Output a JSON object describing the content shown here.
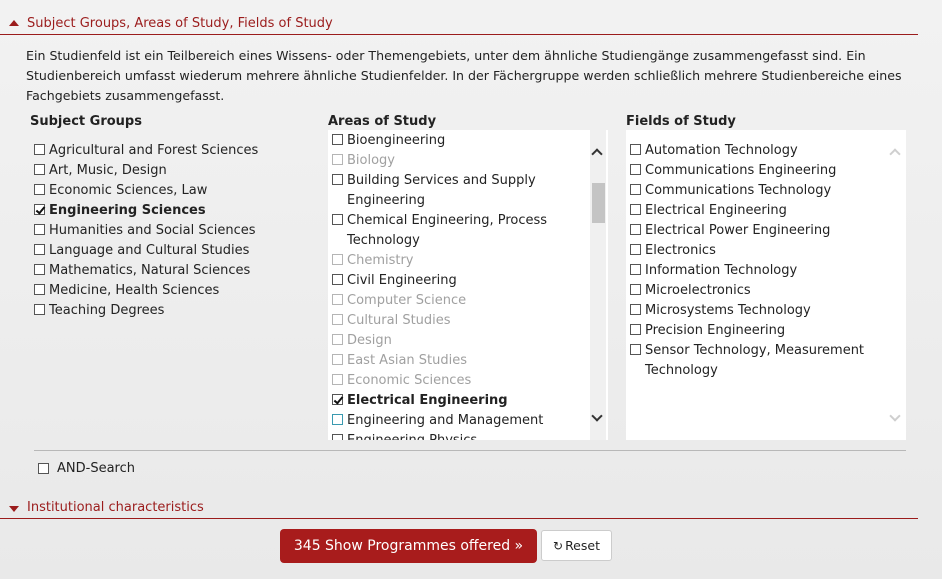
{
  "sections": {
    "subject": "Subject Groups, Areas of Study, Fields of Study",
    "institutional": "Institutional characteristics"
  },
  "description": "Ein Studienfeld ist ein Teilbereich eines Wissens- oder Themengebiets, unter dem ähnliche Studiengänge zusammengefasst sind. Ein Studienbereich umfasst wiederum mehrere ähnliche Studienfelder. In der Fächergruppe werden schließlich mehrere Studienbereiche eines Fachgebiets zusammengefasst.",
  "columns": {
    "groups": "Subject Groups",
    "areas": "Areas of Study",
    "fields": "Fields of Study"
  },
  "subject_groups": [
    {
      "label": "Agricultural and Forest Sciences",
      "checked": false
    },
    {
      "label": "Art, Music, Design",
      "checked": false
    },
    {
      "label": "Economic Sciences, Law",
      "checked": false
    },
    {
      "label": "Engineering Sciences",
      "checked": true
    },
    {
      "label": "Humanities and Social Sciences",
      "checked": false
    },
    {
      "label": "Language and Cultural Studies",
      "checked": false
    },
    {
      "label": "Mathematics, Natural Sciences",
      "checked": false
    },
    {
      "label": "Medicine, Health Sciences",
      "checked": false
    },
    {
      "label": "Teaching Degrees",
      "checked": false
    }
  ],
  "areas_of_study": [
    {
      "label": "Bioengineering",
      "checked": false,
      "disabled": false
    },
    {
      "label": "Biology",
      "checked": false,
      "disabled": true
    },
    {
      "label": "Building Services and Supply Engineering",
      "checked": false,
      "disabled": false
    },
    {
      "label": "Chemical Engineering, Process Technology",
      "checked": false,
      "disabled": false
    },
    {
      "label": "Chemistry",
      "checked": false,
      "disabled": true
    },
    {
      "label": "Civil Engineering",
      "checked": false,
      "disabled": false
    },
    {
      "label": "Computer Science",
      "checked": false,
      "disabled": true
    },
    {
      "label": "Cultural Studies",
      "checked": false,
      "disabled": true
    },
    {
      "label": "Design",
      "checked": false,
      "disabled": true
    },
    {
      "label": "East Asian Studies",
      "checked": false,
      "disabled": true
    },
    {
      "label": "Economic Sciences",
      "checked": false,
      "disabled": true
    },
    {
      "label": "Electrical Engineering",
      "checked": true,
      "disabled": false
    },
    {
      "label": "Engineering and Management",
      "checked": false,
      "disabled": false,
      "focus": true
    },
    {
      "label": "Engineering Physics",
      "checked": false,
      "disabled": false
    }
  ],
  "fields_of_study": [
    {
      "label": "Automation Technology",
      "checked": false
    },
    {
      "label": "Communications Engineering",
      "checked": false
    },
    {
      "label": "Communications Technology",
      "checked": false
    },
    {
      "label": "Electrical Engineering",
      "checked": false
    },
    {
      "label": "Electrical Power Engineering",
      "checked": false
    },
    {
      "label": "Electronics",
      "checked": false
    },
    {
      "label": "Information Technology",
      "checked": false
    },
    {
      "label": "Microelectronics",
      "checked": false
    },
    {
      "label": "Microsystems Technology",
      "checked": false
    },
    {
      "label": "Precision Engineering",
      "checked": false
    },
    {
      "label": "Sensor Technology, Measurement Technology",
      "checked": false
    }
  ],
  "and_search": {
    "label": "AND-Search",
    "checked": false
  },
  "buttons": {
    "show": "345 Show Programmes offered »",
    "reset": "Reset",
    "reset_icon": "refresh-icon"
  },
  "colors": {
    "accent": "#a81c1c"
  }
}
